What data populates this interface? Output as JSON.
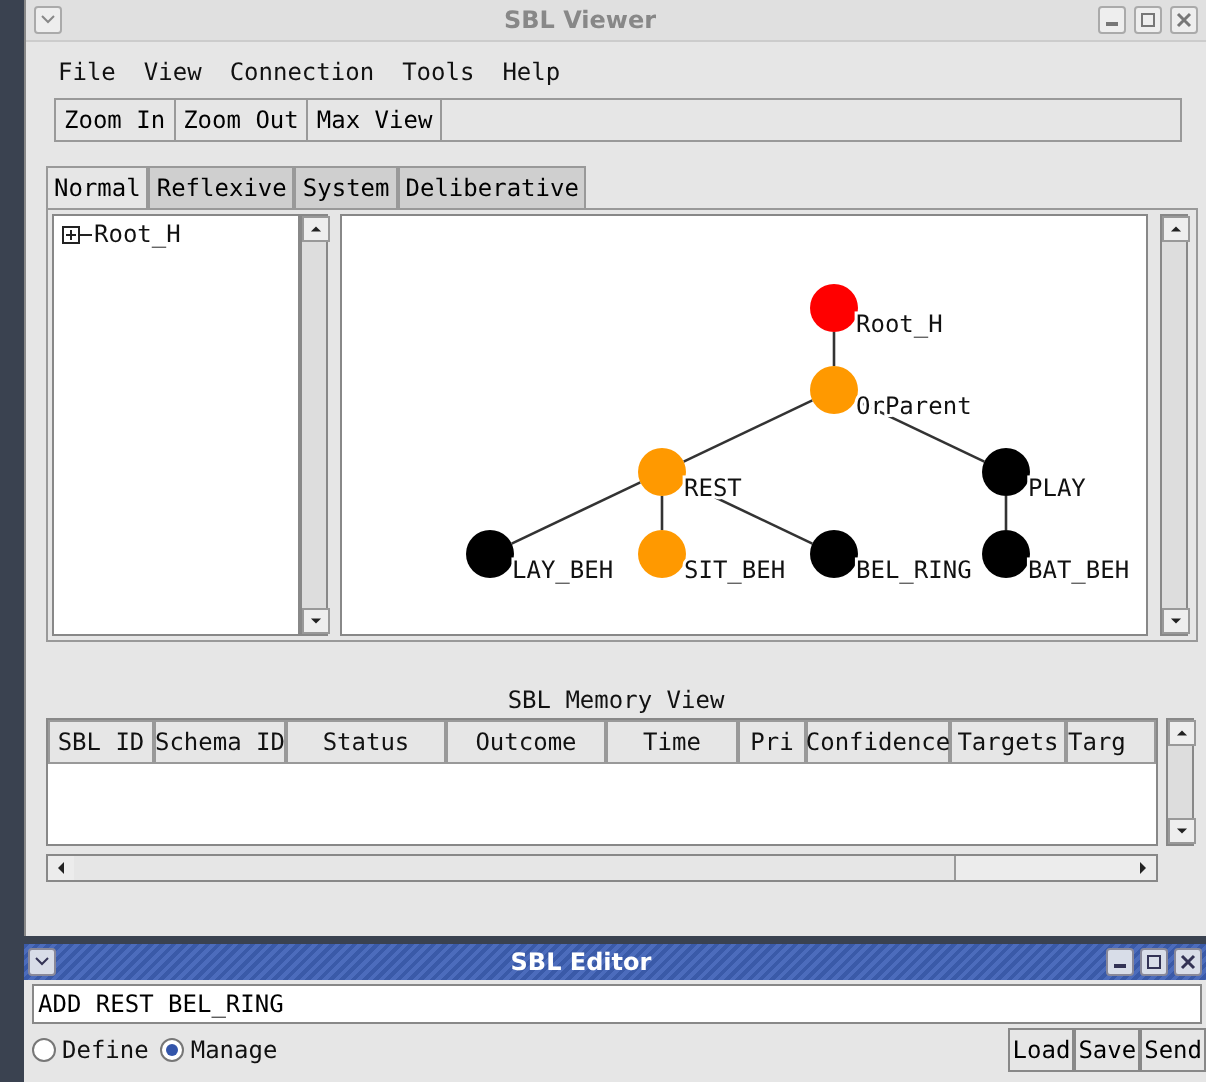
{
  "window": {
    "title": "SBL Viewer"
  },
  "menu": [
    "File",
    "View",
    "Connection",
    "Tools",
    "Help"
  ],
  "toolbar": [
    "Zoom In",
    "Zoom Out",
    "Max View"
  ],
  "tabs": [
    {
      "label": "Normal",
      "selected": true
    },
    {
      "label": "Reflexive",
      "selected": false
    },
    {
      "label": "System",
      "selected": false
    },
    {
      "label": "Deliberative",
      "selected": false
    }
  ],
  "tree": [
    {
      "label": "Root_H",
      "expanded": false
    }
  ],
  "graph": {
    "root": {
      "name": "Root_H",
      "color": "#ff0000",
      "children": [
        {
          "name": "OrParent",
          "color": "#ff9900",
          "children": [
            {
              "name": "REST",
              "color": "#ff9900",
              "children": [
                {
                  "name": "LAY_BEH",
                  "color": "#000000"
                },
                {
                  "name": "SIT_BEH",
                  "color": "#ff9900"
                },
                {
                  "name": "BEL_RING",
                  "color": "#000000"
                }
              ]
            },
            {
              "name": "PLAY",
              "color": "#000000",
              "children": [
                {
                  "name": "BAT_BEH",
                  "color": "#000000"
                }
              ]
            }
          ]
        }
      ]
    }
  },
  "memory_view": {
    "title": "SBL Memory View",
    "columns": [
      "SBL ID",
      "Schema ID",
      "Status",
      "Outcome",
      "Time",
      "Pri",
      "Confidence",
      "Targets",
      "Targ"
    ]
  },
  "editor": {
    "title": "SBL Editor",
    "command": "ADD REST BEL_RING",
    "modes": [
      {
        "label": "Define",
        "selected": false
      },
      {
        "label": "Manage",
        "selected": true
      }
    ],
    "buttons": [
      "Load",
      "Save",
      "Send"
    ]
  }
}
